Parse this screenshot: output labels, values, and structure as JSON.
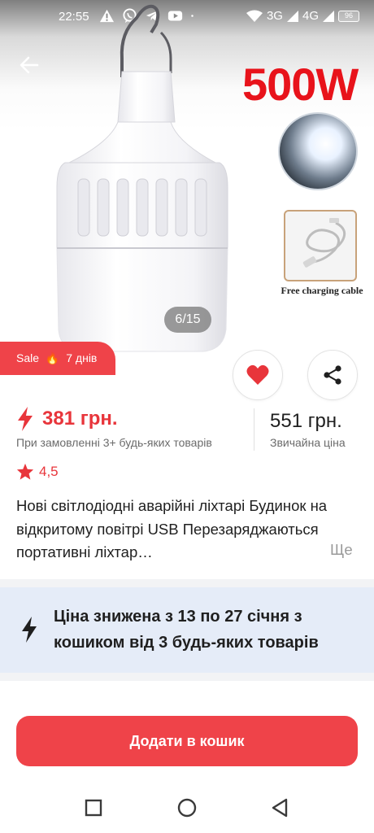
{
  "status_bar": {
    "time": "22:55",
    "left_icons": [
      "warning-icon",
      "viber-icon",
      "telegram-icon",
      "youtube-icon",
      "dot-icon"
    ],
    "network_3g": "3G",
    "network_4g": "4G",
    "battery": "96"
  },
  "header": {
    "back_icon": "arrow-left-icon"
  },
  "gallery": {
    "promo_text": "500W",
    "cable_caption": "Free charging cable",
    "counter": "6/15"
  },
  "sale_badge": {
    "label": "Sale",
    "emoji": "🔥",
    "duration": "7 днів"
  },
  "actions": {
    "favorite_icon": "heart-icon",
    "share_icon": "share-icon"
  },
  "price": {
    "discounted": "381 грн.",
    "discounted_note": "При замовленні 3+ будь-яких товарів",
    "regular": "551 грн.",
    "regular_note": "Звичайна ціна"
  },
  "rating": {
    "value": "4,5"
  },
  "product": {
    "title": "Нові світлодіодні аварійні ліхтарі Будинок на відкритому повітрі USB Перезаряджаються портативні ліхтар…",
    "more_label": "Ще"
  },
  "promo_banner": {
    "text": "Ціна знижена з 13 по 27 січня з кошиком від 3 будь-яких товарів"
  },
  "cart": {
    "add_label": "Додати в кошик"
  },
  "colors": {
    "accent": "#ef4349",
    "price_red": "#e8353b",
    "banner_bg": "#e5ecf8"
  },
  "nav_bar": {
    "buttons": [
      "recent-apps-icon",
      "home-icon",
      "back-icon"
    ]
  }
}
